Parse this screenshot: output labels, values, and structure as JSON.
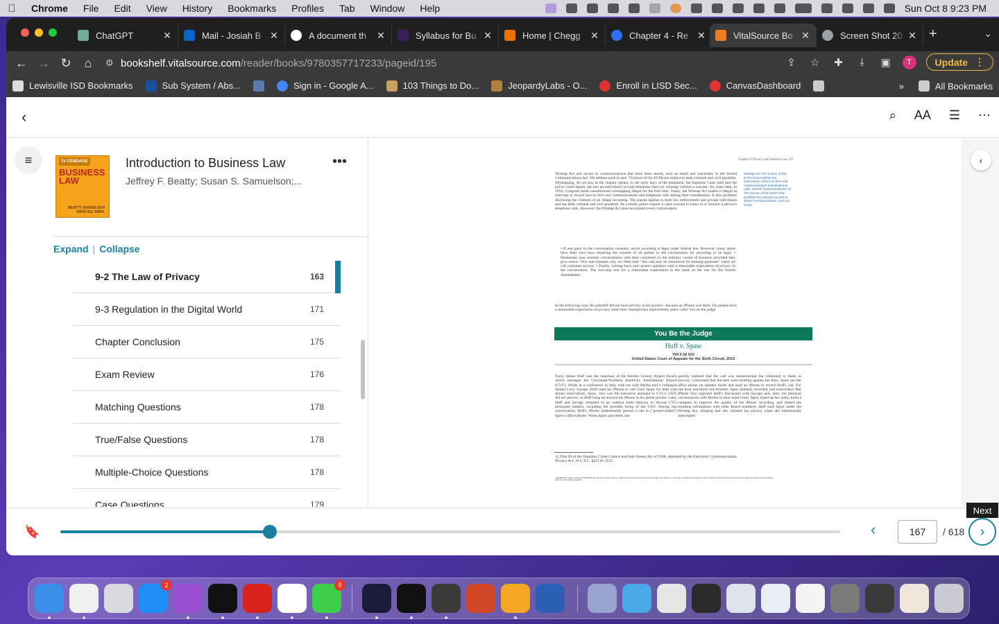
{
  "menubar": {
    "app": "Chrome",
    "items": [
      "File",
      "Edit",
      "View",
      "History",
      "Bookmarks",
      "Profiles",
      "Tab",
      "Window",
      "Help"
    ],
    "clock": "Sun Oct 8  9:23 PM"
  },
  "tabs": [
    {
      "title": "ChatGPT",
      "color": "#74aa9c"
    },
    {
      "title": "Mail - Josiah B",
      "color": "#0a64c8"
    },
    {
      "title": "A document th",
      "color": "#ffffff"
    },
    {
      "title": "Syllabus for Bu",
      "color": "#3c1e5a"
    },
    {
      "title": "Home | Chegg",
      "color": "#eb7100"
    },
    {
      "title": "Chapter 4 - Re",
      "color": "#2e6ff2"
    },
    {
      "title": "VitalSource Bo",
      "color": "#ef7d22"
    },
    {
      "title": "Screen Shot 20",
      "color": "#9aa0a6"
    }
  ],
  "address": {
    "host": "bookshelf.vitalsource.com",
    "path": "/reader/books/9780357717233/pageid/195"
  },
  "update_label": "Update",
  "bookmarks": [
    {
      "label": "Lewisville ISD Bookmarks",
      "color": "#dddddd"
    },
    {
      "label": "Sub System / Abs...",
      "color": "#1b4fa0"
    },
    {
      "label": "",
      "color": "#5a7ab0"
    },
    {
      "label": "Sign in - Google A...",
      "color": "#4285f4"
    },
    {
      "label": "103 Things to Do...",
      "color": "#c8a060"
    },
    {
      "label": "JeopardyLabs - O...",
      "color": "#b08040"
    },
    {
      "label": "Enroll in LISD Sec...",
      "color": "#d33"
    },
    {
      "label": "CanvasDashboard",
      "color": "#d33"
    }
  ],
  "all_bookmarks": "All Bookmarks",
  "book": {
    "title": "Introduction to Business Law",
    "authors": "Jeffrey F. Beatty; Susan S. Samuelson;...",
    "cover_title": "BUSINESS LAW",
    "cover_edition": "7e CENGAGE",
    "cover_authors": "BEATTY SAMUELSON SÁNCHEZ ABRIL"
  },
  "toc_controls": {
    "expand": "Expand",
    "collapse": "Collapse"
  },
  "toc": [
    {
      "label": "9-2 The Law of Privacy",
      "page": "163",
      "current": true
    },
    {
      "label": "9-3 Regulation in the Digital World",
      "page": "171"
    },
    {
      "label": "Chapter Conclusion",
      "page": "175"
    },
    {
      "label": "Exam Review",
      "page": "176"
    },
    {
      "label": "Matching Questions",
      "page": "178"
    },
    {
      "label": "True/False Questions",
      "page": "178"
    },
    {
      "label": "Multiple-Choice Questions",
      "page": "178"
    },
    {
      "label": "Case Questions",
      "page": "179"
    }
  ],
  "page_content": {
    "running_head": "Chapter 9   Privacy and Internet Law        167",
    "col_main": "Wiretap Act and access to communications that have been stored, such as email and voicemail, in the Stored Communications Act. We address each in turn. Violators of the ECPA are subject to both criminal and civil penalties. Wiretapping. As we saw in the chapter opener, in the early days of the telephone, the Supreme Court held that the police could legally tap into an individual's private telephone lines (or wiretap) without a warrant. Six years later, in 1934, Congress made unauthorized wiretapping illegal for the first time. Today, the Wiretap Act makes it illegal to intercept or record face-to-face oral communications and telephone calls during their transmission. It also prohibits disclosing the contents of an illegal recording. The statute applies to both law enforcement and private individuals and has both criminal and civil penalties. As a result, police require a valid warrant to listen in or monitor a person's telephone calls. However, the Wiretap Act does not protect every conversation.",
    "bullets": "• If one party to the conversation consents, secret recording is legal under federal law. However, many states have their own laws requiring the consent of all parties to the conversation for recording to be legal.  • Businesses may monitor conversations with their customers in the ordinary course of business provided they give notice. This rule explains why we often hear \"this call may be monitored for training purposes\" when we call customer service.  • Finally, wiretap laws only protect speakers with a reasonable expectation of privacy in the conversation. The two-step test for a reasonable expectation is the same as the one for the Fourth Amendment.",
    "transition": "In the following case, the plaintiff did not have privacy in his pocket—because an iPhone was there. Do people have a reasonable expectation of privacy when their smartphones inadvertently place calls? You be the judge.",
    "margin_notes": "Wiretap Act The section of the ECPA that prohibits the interception of face-to-face oral communications and telephone calls. Stored Communications Act The section of the ECPA that prohibits the unlawful access to stored communications, such as email.",
    "judge_bar": "You Be the Judge",
    "case_name": "Huff v. Spaw",
    "case_cite": "794 F.3d 543\nUnited States Court of Appeals for the Sixth Circuit, 2015",
    "facts_left": "Facts: James Huff was the chairman of the Kenton County Airport Board, which manages the Cincinnati/Northern Kentucky International Airport (CVG). While at a conference in Italy with his wife Bertha and a colleague named Larry Savage, Huff used his iPhone to call Carol Spaw for help with dinner reservations. Spaw, who was the executive assistant to CVG's CEO, did not answer, so Huff hung up and put his iPhone in his jacket pocket. Later, Huff and Savage retreated to an outdoor hotel balcony to discuss CVG personnel matters, including the possible firing of the CEO. During this conversation, Huff's iPhone inadvertently placed a call to (\"pocket-dialed\") Spaw's office phone. When Spaw answered, she",
    "facts_right": "quickly realized that the call was unintentional but continued to listen in anyway. Concerned that the men were plotting against her boss, Spaw put her office phone on speaker mode and used an iPhone to record Huff's call. For one hour and thirty-one minutes, Spaw listened, recorded, and transcribed. Her iPhone first captured Huff's discussion with Savage and, later, his personal conversations with Bertha in their hotel room. Spaw typed up her notes, hired a company to improve the quality of the iPhone recording, and shared the resulting information with other Board members. Huff sued Spaw under the Wiretap Act, alleging that she violated his privacy when she intentionally intercepted",
    "footnote": "12 Title III of the Omnibus Crime Control and Safe Streets Act of 1968, amended by the Electronic Communications Privacy Act, 18 U.S.C. §§2510–2522.",
    "copyright": "Copyright 2024 Cengage Learning. All Rights Reserved. May not be copied, scanned, or duplicated, in whole or in part. Due to electronic rights, some third party content may be suppressed from the eBook and/or eChapter(s). Editorial review has deemed that any suppressed content does not materially affect the overall learning experience."
  },
  "navigation": {
    "current_page": "167",
    "total": "/ 618",
    "progress_fraction": 0.269,
    "next_tooltip": "Next"
  },
  "dock": [
    {
      "name": "finder",
      "color": "#3b8fe8",
      "badge": ""
    },
    {
      "name": "photos-like",
      "color": "#f0f0f0",
      "badge": ""
    },
    {
      "name": "launchpad",
      "color": "#d9d9e0",
      "badge": ""
    },
    {
      "name": "app-store",
      "color": "#1e8ef5",
      "badge": "2"
    },
    {
      "name": "podcasts",
      "color": "#9a4ed0",
      "badge": ""
    },
    {
      "name": "apple-tv",
      "color": "#111111",
      "badge": ""
    },
    {
      "name": "acrobat",
      "color": "#d8231c",
      "badge": ""
    },
    {
      "name": "chrome",
      "color": "#ffffff",
      "badge": ""
    },
    {
      "name": "messages",
      "color": "#3ecf4a",
      "badge": "9"
    },
    {
      "name": "webex",
      "color": "#1b1b3a",
      "badge": ""
    },
    {
      "name": "spotify",
      "color": "#111111",
      "badge": ""
    },
    {
      "name": "keychain",
      "color": "#3a3a3a",
      "badge": ""
    },
    {
      "name": "powerpoint",
      "color": "#d24726",
      "badge": ""
    },
    {
      "name": "keynote",
      "color": "#f5a623",
      "badge": ""
    },
    {
      "name": "word",
      "color": "#2b5fb4",
      "badge": ""
    },
    {
      "name": "help",
      "color": "#9aa4d0",
      "badge": ""
    },
    {
      "name": "folder",
      "color": "#4aa8e8",
      "badge": ""
    },
    {
      "name": "png-file",
      "color": "#e6e6e6",
      "badge": ""
    },
    {
      "name": "screenshot-1",
      "color": "#2a2a2a",
      "badge": ""
    },
    {
      "name": "screenshot-2",
      "color": "#dfe3ea",
      "badge": ""
    },
    {
      "name": "screenshot-3",
      "color": "#e9edf4",
      "badge": ""
    },
    {
      "name": "screenshot-4",
      "color": "#f4f4f4",
      "badge": ""
    },
    {
      "name": "screenshot-5",
      "color": "#7a7a7a",
      "badge": ""
    },
    {
      "name": "screenshot-6",
      "color": "#3a3a3a",
      "badge": ""
    },
    {
      "name": "screenshot-7",
      "color": "#f0e6dc",
      "badge": ""
    },
    {
      "name": "trash",
      "color": "#c8ccd2",
      "badge": ""
    }
  ]
}
